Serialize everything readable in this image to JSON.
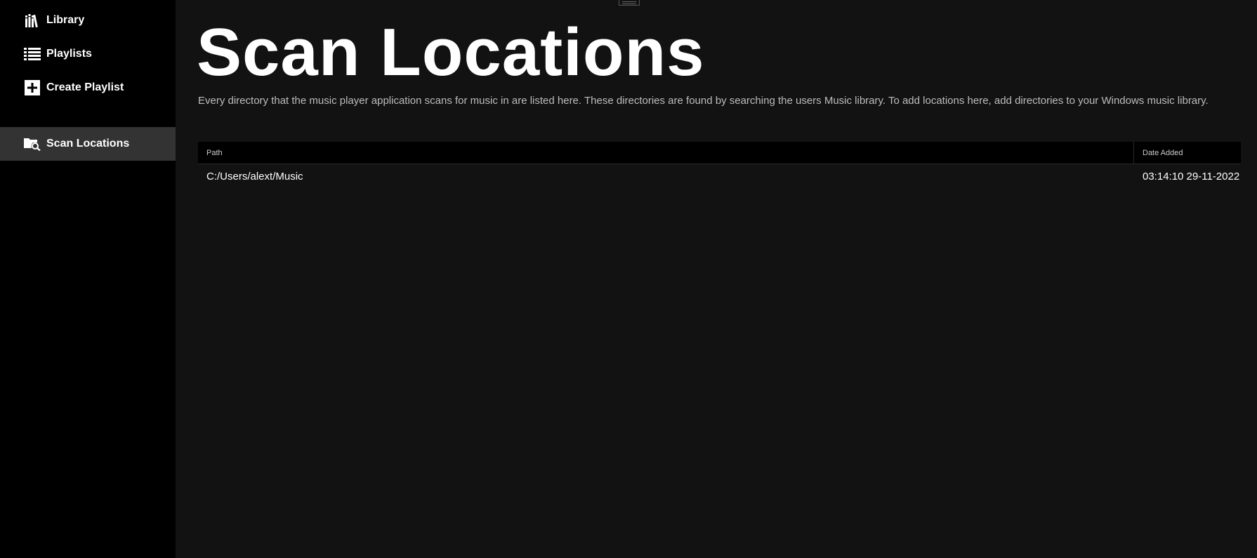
{
  "sidebar": {
    "items": [
      {
        "label": "Library",
        "icon": "library-icon",
        "active": false
      },
      {
        "label": "Playlists",
        "icon": "playlists-icon",
        "active": false
      },
      {
        "label": "Create Playlist",
        "icon": "add-icon",
        "active": false
      },
      {
        "label": "Scan Locations",
        "icon": "folder-search-icon",
        "active": true
      }
    ]
  },
  "main": {
    "title": "Scan Locations",
    "description": "Every directory that the music player application scans for music in are listed here. These directories are found by searching the users Music library. To add locations here, add directories to your Windows music library."
  },
  "table": {
    "columns": [
      "Path",
      "Date Added"
    ],
    "rows": [
      {
        "path": "C:/Users/alext/Music",
        "date_added": "03:14:10 29-11-2022"
      }
    ]
  },
  "colors": {
    "sidebar_bg": "#000000",
    "main_bg": "#121212",
    "active_item_bg": "#333333",
    "text": "#ffffff",
    "muted_text": "#bdbdbd"
  }
}
